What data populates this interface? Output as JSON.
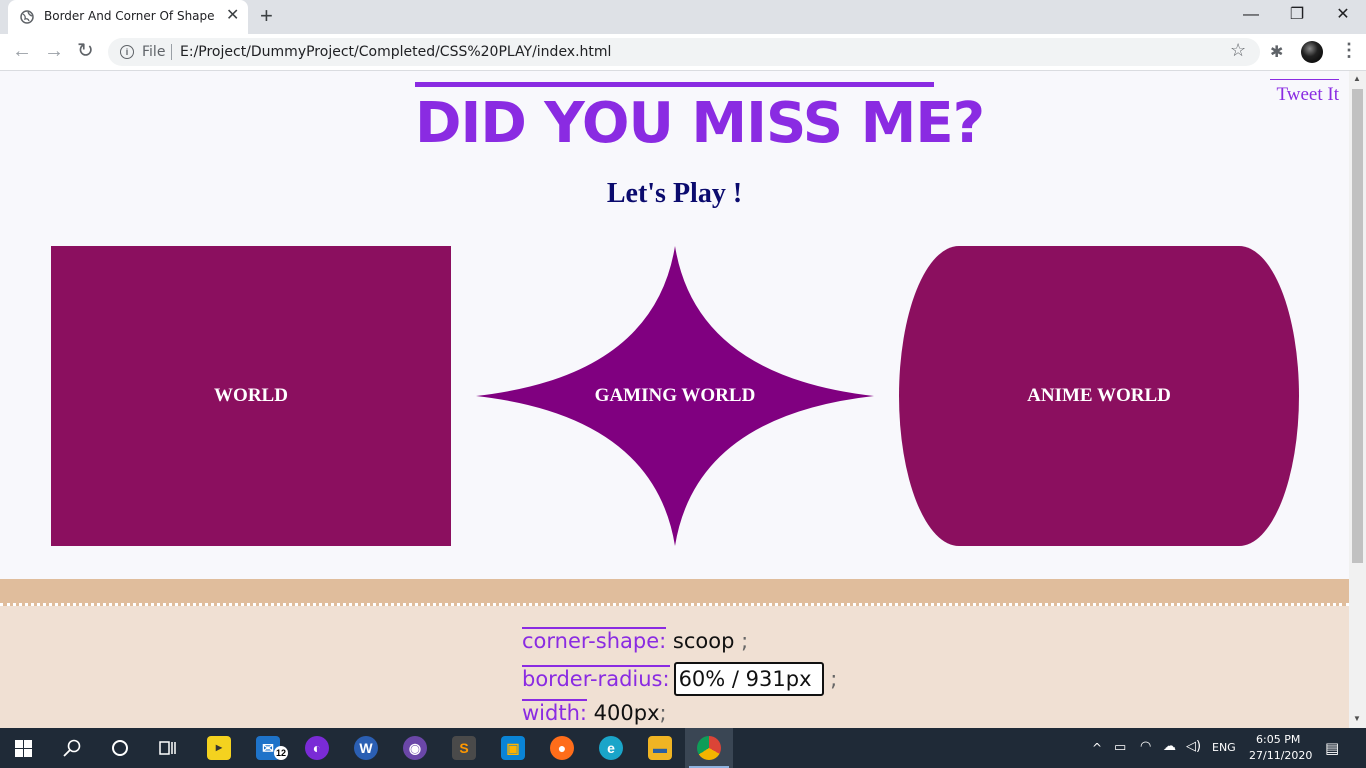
{
  "browser": {
    "tab_title": "Border And Corner Of Shape",
    "tab_close": "✕",
    "new_tab": "+",
    "window": {
      "minimize": "—",
      "restore": "❐",
      "close": "✕"
    },
    "nav": {
      "back": "←",
      "forward": "→",
      "reload": "↻"
    },
    "omnibox": {
      "info": "i",
      "scheme_label": "File",
      "url": "E:/Project/DummyProject/Completed/CSS%20PLAY/index.html"
    },
    "icons": {
      "star": "☆",
      "extensions": "✱",
      "menu": "⋮"
    }
  },
  "page": {
    "headline": "DID YOU MISS ME?",
    "tweet_link": "Tweet It",
    "subhead": "Let's Play !",
    "shapes": [
      {
        "label": "WORLD"
      },
      {
        "label": "GAMING WORLD"
      },
      {
        "label": "ANIME WORLD"
      }
    ],
    "shape_color": "#8b0f5f",
    "scoop_color": "#800080",
    "accent_color": "#8a2be2",
    "code": {
      "line1": {
        "prop": "corner-shape:",
        "value": "scoop",
        "semi": ";"
      },
      "line2": {
        "prop": "border-radius:",
        "value": "60% / 931px",
        "semi": ";"
      },
      "line3": {
        "prop": "width:",
        "value": "400px",
        "semi": ";"
      }
    }
  },
  "taskbar": {
    "mail_badge": "12",
    "language": "ENG",
    "time": "6:05 PM",
    "date": "27/11/2020",
    "apps": [
      "windows-start",
      "search",
      "cortana",
      "task-view",
      "player",
      "mail",
      "tor",
      "word",
      "github-desktop",
      "sublime-text",
      "squares-app",
      "firefox",
      "edge",
      "file-explorer",
      "chrome"
    ]
  }
}
